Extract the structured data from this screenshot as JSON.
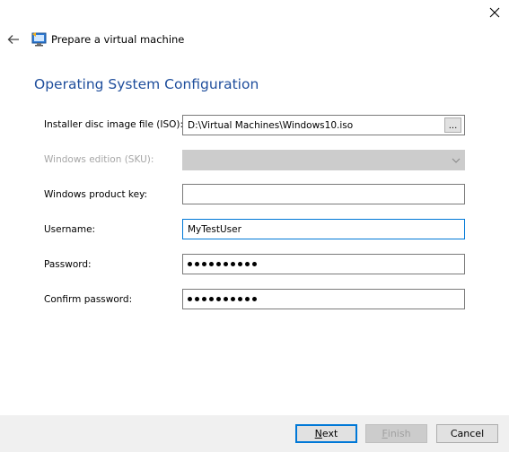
{
  "window": {
    "title": "Prepare a virtual machine",
    "close_icon": "close-icon",
    "back_icon": "back-arrow-icon",
    "app_icon": "virtual-machine-icon"
  },
  "page": {
    "title": "Operating System Configuration"
  },
  "form": {
    "iso": {
      "label": "Installer disc image file (ISO):",
      "value": "D:\\Virtual Machines\\Windows10.iso",
      "browse_label": "..."
    },
    "sku": {
      "label": "Windows edition (SKU):",
      "value": "",
      "enabled": false
    },
    "product_key": {
      "label": "Windows product key:",
      "value": ""
    },
    "username": {
      "label": "Username:",
      "value": "MyTestUser"
    },
    "password": {
      "label": "Password:",
      "masked_length": 10
    },
    "confirm_password": {
      "label": "Confirm password:",
      "masked_length": 10
    }
  },
  "buttons": {
    "next": {
      "label_mnemonic": "N",
      "label_rest": "ext"
    },
    "finish": {
      "label_mnemonic": "F",
      "label_rest": "inish",
      "enabled": false
    },
    "cancel": {
      "label": "Cancel"
    }
  },
  "colors": {
    "accent": "#0078d7",
    "title_blue": "#1f4e9c"
  }
}
